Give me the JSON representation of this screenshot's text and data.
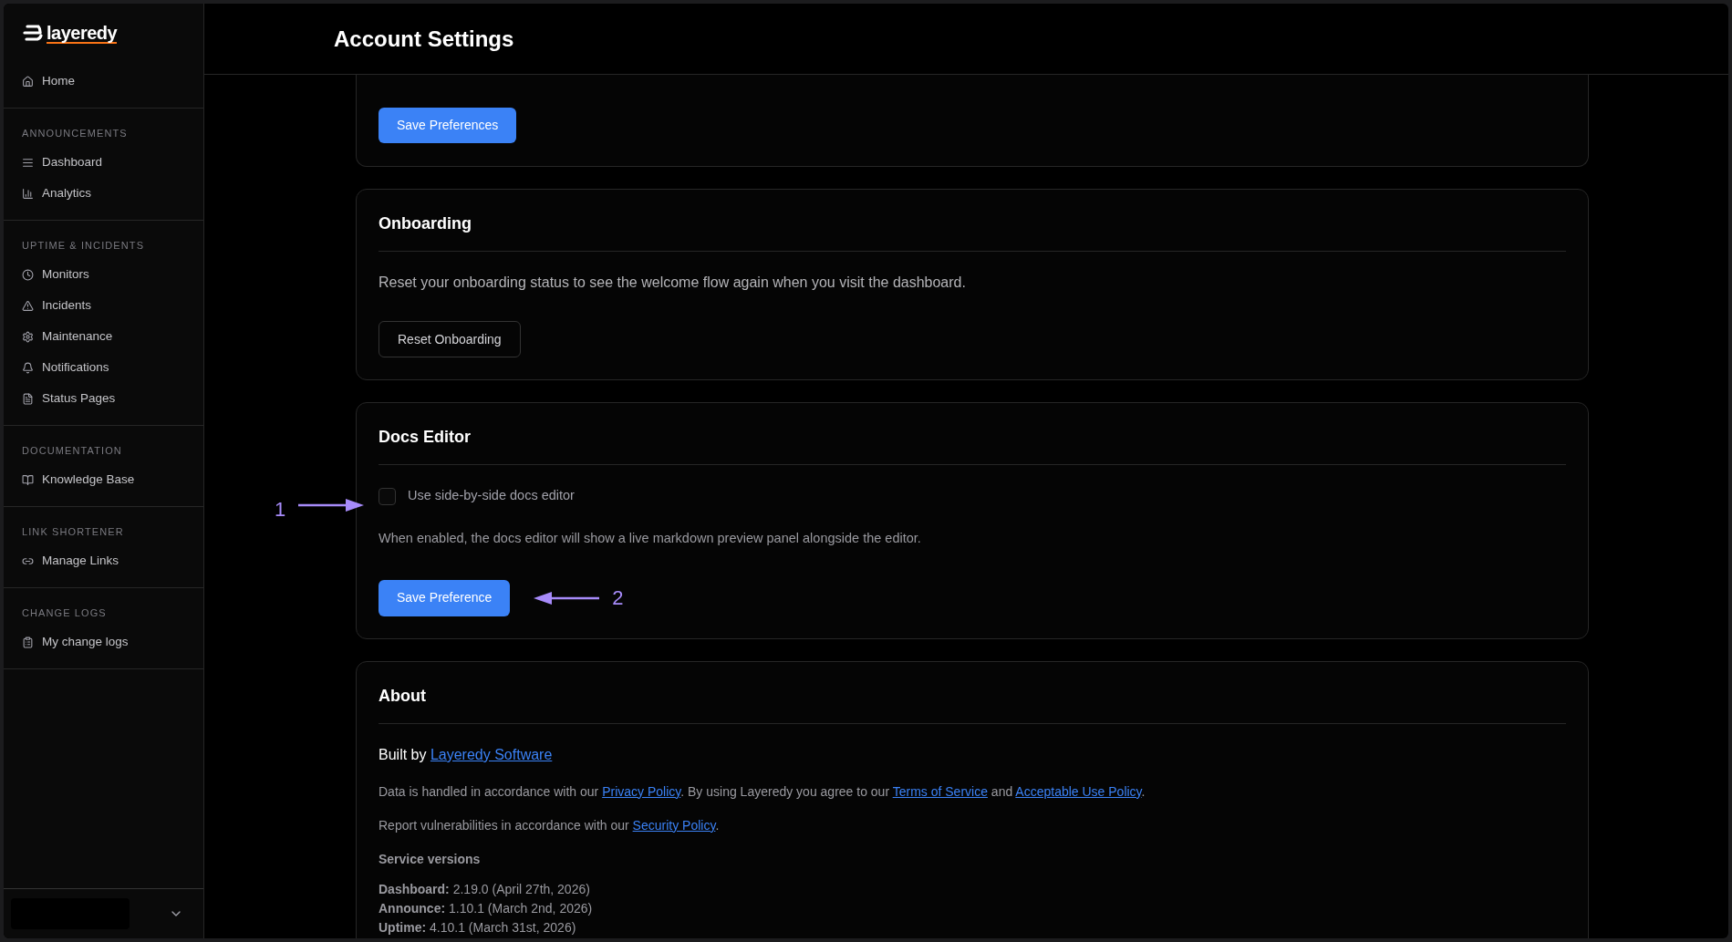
{
  "sidebar": {
    "logo": "layeredy",
    "home": {
      "label": "Home"
    },
    "sections": [
      {
        "title": "ANNOUNCEMENTS",
        "items": [
          {
            "label": "Dashboard"
          },
          {
            "label": "Analytics"
          }
        ]
      },
      {
        "title": "UPTIME & INCIDENTS",
        "items": [
          {
            "label": "Monitors"
          },
          {
            "label": "Incidents"
          },
          {
            "label": "Maintenance"
          },
          {
            "label": "Notifications"
          },
          {
            "label": "Status Pages"
          }
        ]
      },
      {
        "title": "DOCUMENTATION",
        "items": [
          {
            "label": "Knowledge Base"
          }
        ]
      },
      {
        "title": "LINK SHORTENER",
        "items": [
          {
            "label": "Manage Links"
          }
        ]
      },
      {
        "title": "CHANGE LOGS",
        "items": [
          {
            "label": "My change logs"
          }
        ]
      }
    ]
  },
  "header": {
    "title": "Account Settings"
  },
  "preferences_card": {
    "button": "Save Preferences"
  },
  "onboarding_card": {
    "title": "Onboarding",
    "text": "Reset your onboarding status to see the welcome flow again when you visit the dashboard.",
    "button": "Reset Onboarding"
  },
  "docs_editor_card": {
    "title": "Docs Editor",
    "checkbox": {
      "label": "Use side-by-side docs editor",
      "checked": false
    },
    "description": "When enabled, the docs editor will show a live markdown preview panel alongside the editor.",
    "button": "Save Preference"
  },
  "annotations": [
    {
      "label": "1"
    },
    {
      "label": "2"
    }
  ],
  "about_card": {
    "title": "About",
    "built_by": {
      "text": "Built by",
      "link": "Layeredy Software"
    },
    "legal": [
      {
        "kind": "text",
        "text": "Data is handled in accordance with our "
      },
      {
        "kind": "link",
        "text": "Privacy Policy"
      },
      {
        "kind": "text",
        "text": ". By using Layeredy you agree to our "
      },
      {
        "kind": "link",
        "text": "Terms of Service"
      },
      {
        "kind": "text",
        "text": " and "
      },
      {
        "kind": "link",
        "text": "Acceptable Use Policy"
      },
      {
        "kind": "text",
        "text": "."
      }
    ],
    "security": [
      {
        "kind": "text",
        "text": "Report vulnerabilities in accordance with our "
      },
      {
        "kind": "link",
        "text": "Security Policy"
      },
      {
        "kind": "text",
        "text": "."
      }
    ],
    "versions_title": "Service versions",
    "versions": [
      {
        "name": "Dashboard:",
        "value": "2.19.0 (April 27th, 2026)"
      },
      {
        "name": "Announce:",
        "value": "1.10.1 (March 2nd, 2026)"
      },
      {
        "name": "Uptime:",
        "value": "4.10.1 (March 31st, 2026)"
      }
    ]
  }
}
